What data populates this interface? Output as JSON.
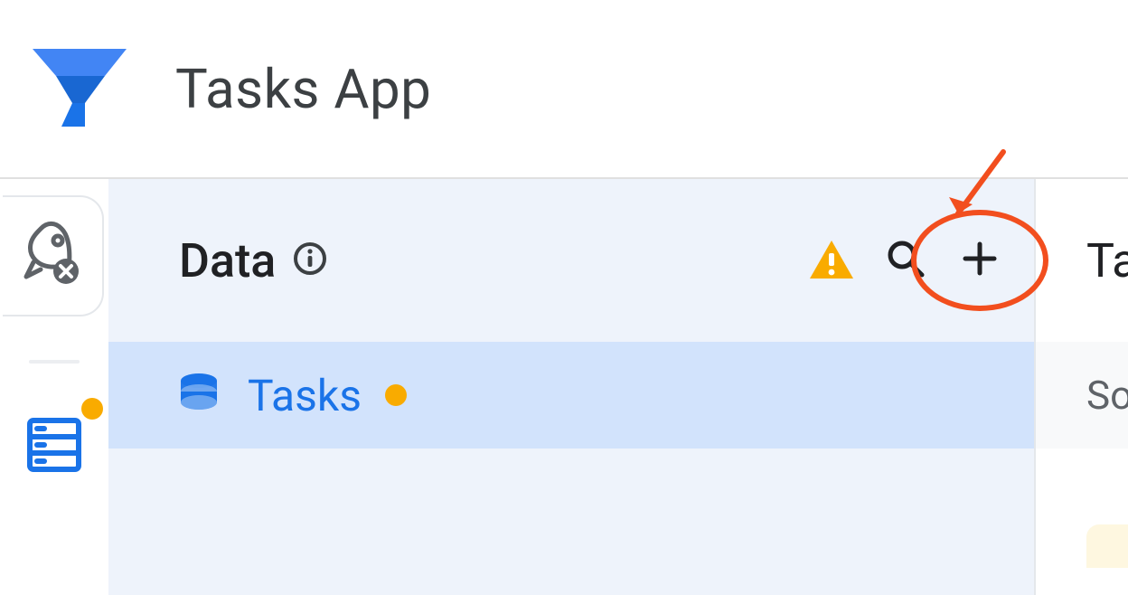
{
  "header": {
    "title": "Tasks App"
  },
  "left_rail": {
    "items": [
      {
        "name": "deploy",
        "icon": "rocket-cancel-icon",
        "has_warning": false
      },
      {
        "name": "data",
        "icon": "database-icon",
        "has_warning": true
      }
    ]
  },
  "data_panel": {
    "title": "Data",
    "tables": [
      {
        "name": "Tasks",
        "status": "warning"
      }
    ]
  },
  "right_panel": {
    "title_fragment": "Ta",
    "subtitle_fragment": "So"
  },
  "colors": {
    "accent_blue": "#1a73e8",
    "warning_orange": "#f9ab00",
    "annotation_red": "#F24E1E",
    "panel_bg": "#eef3fb",
    "row_selected": "#d2e3fc"
  }
}
